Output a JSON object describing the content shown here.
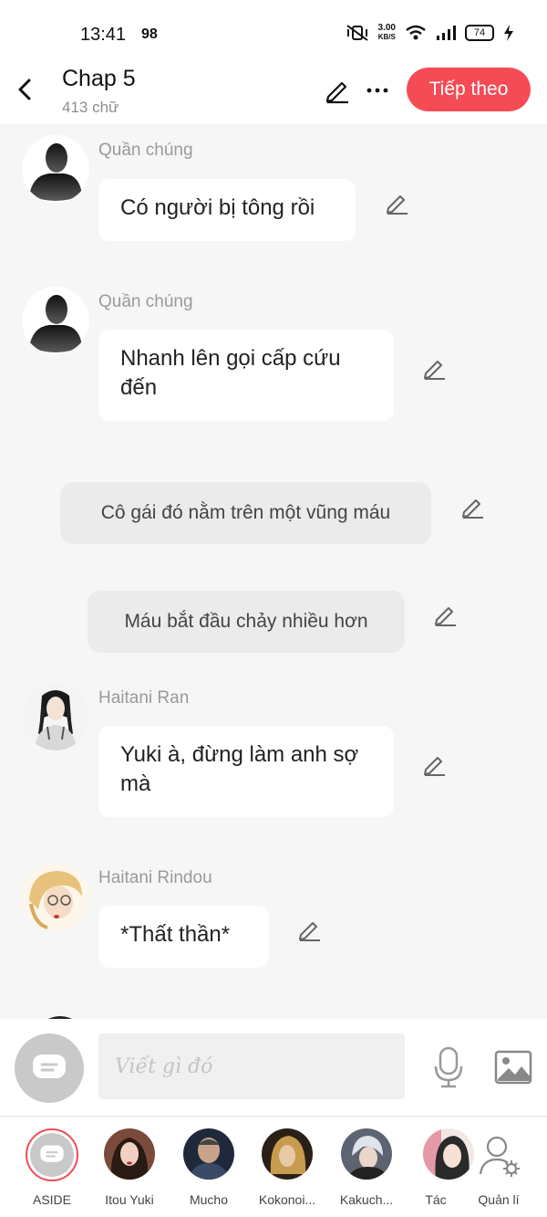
{
  "status": {
    "time": "13:41",
    "indicator": "98",
    "net_speed_value": "3.00",
    "net_speed_unit": "KB/S",
    "battery": "74"
  },
  "header": {
    "title": "Chap 5",
    "word_count": "413 chữ",
    "next_label": "Tiếp theo"
  },
  "messages": [
    {
      "sender": "Quần chúng",
      "text": "Có người bị tông rồi"
    },
    {
      "sender": "Quần chúng",
      "text": "Nhanh lên gọi cấp cứu đến"
    },
    {
      "narration": "Cô gái đó nằm trên một vũng máu"
    },
    {
      "narration": "Máu bắt đầu chảy nhiều hơn"
    },
    {
      "sender": "Haitani Ran",
      "text": "Yuki à, đừng làm anh sợ mà"
    },
    {
      "sender": "Haitani Rindou",
      "text": "*Thất thần*"
    }
  ],
  "input": {
    "placeholder": "Viết gì đó"
  },
  "characters": [
    {
      "name": "ASIDE"
    },
    {
      "name": "Itou Yuki"
    },
    {
      "name": "Mucho"
    },
    {
      "name": "Kokonoi..."
    },
    {
      "name": "Kakuch..."
    },
    {
      "name": "Tác"
    },
    {
      "name": "Quản lí"
    }
  ],
  "colors": {
    "accent": "#f44b55",
    "background": "#f6f6f6",
    "bubble": "#ffffff",
    "narration": "#ebebeb"
  }
}
